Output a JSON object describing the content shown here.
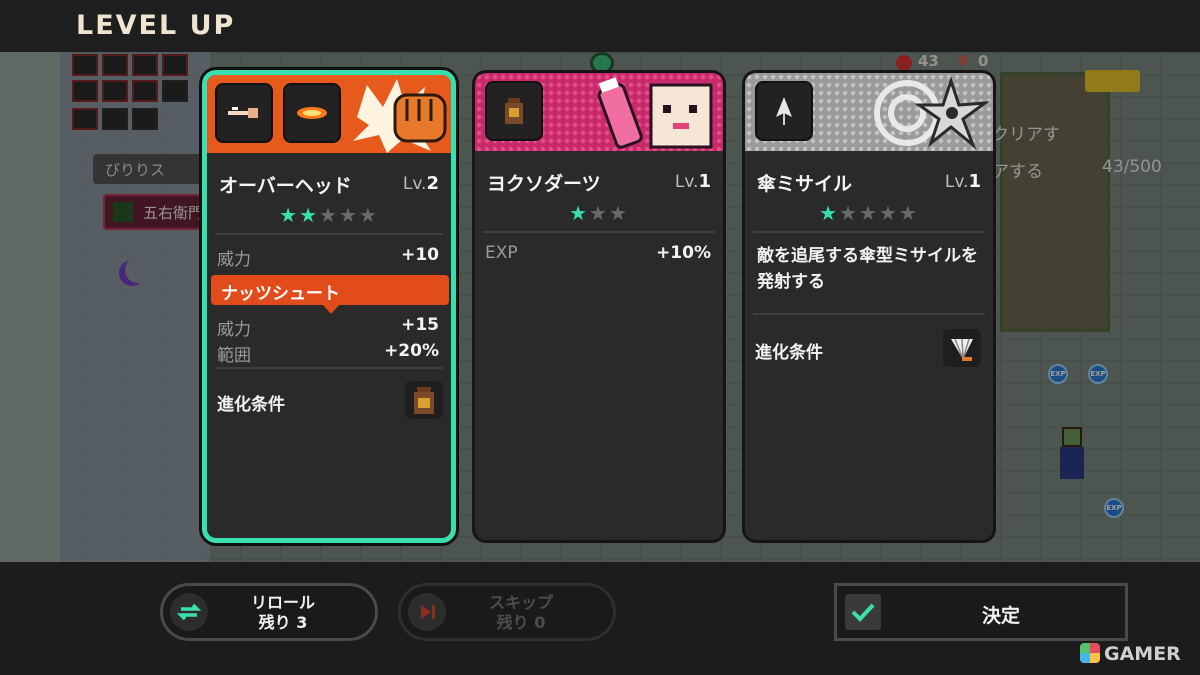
{
  "header": {
    "title": "LEVEL UP"
  },
  "scene": {
    "hud": {
      "kills": "43",
      "money_symbol": "¥",
      "money": "0"
    },
    "tags": [
      "びりりス",
      "五右衛門"
    ],
    "quest_line_1": "クリアす",
    "quest_line_2": "アする",
    "quest_progress": "43/500",
    "exp_badge": "EXP"
  },
  "cards": [
    {
      "name": "オーバーヘッド",
      "level_prefix": "Lv.",
      "level": "2",
      "stars_filled": 2,
      "stars_total": 5,
      "stats": [
        {
          "label": "威力",
          "value": "+10"
        }
      ],
      "evolution": {
        "name": "ナッツシュート",
        "stats": [
          {
            "label": "威力",
            "value": "+15"
          },
          {
            "label": "範囲",
            "value": "+20%"
          }
        ]
      },
      "condition_label": "進化条件",
      "selected": true,
      "art_color": "#e65a1c",
      "icons": [
        "overhead-kick-icon",
        "fireball-icon",
        "fist-icon"
      ]
    },
    {
      "name": "ヨクソダーツ",
      "level_prefix": "Lv.",
      "level": "1",
      "stars_filled": 1,
      "stars_total": 3,
      "stats": [
        {
          "label": "EXP",
          "value": "+10%"
        }
      ],
      "selected": false,
      "art_color": "#c82a6a",
      "icons": [
        "jar-icon",
        "bottle-icon",
        "cat-character-icon"
      ]
    },
    {
      "name": "傘ミサイル",
      "level_prefix": "Lv.",
      "level": "1",
      "stars_filled": 1,
      "stars_total": 5,
      "description": "敵を追尾する傘型ミサイルを発射する",
      "condition_label": "進化条件",
      "selected": false,
      "art_color": "#9a9a9a",
      "icons": [
        "umbrella-icon",
        "shuriken-icon",
        "fan-icon"
      ]
    }
  ],
  "actions": {
    "reroll": {
      "line1": "リロール",
      "line2": "残り 3"
    },
    "skip": {
      "line1": "スキップ",
      "line2": "残り 0"
    },
    "confirm": "決定"
  },
  "accent_color": "#38e0b0",
  "watermark": "GAMER"
}
